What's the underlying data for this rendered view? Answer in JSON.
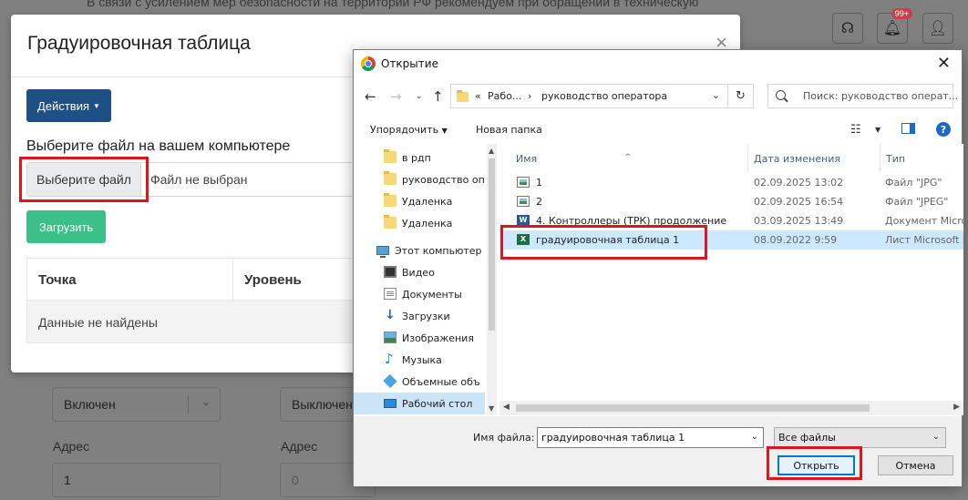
{
  "background": {
    "notice": "В связи с усилением мер безопасности на территории РФ рекомендуем при обращении в техническую",
    "notifications_badge": "99+",
    "fields": [
      {
        "value": "Включен"
      },
      {
        "value": "Выключен"
      }
    ],
    "address_label": "Адрес",
    "address_values": [
      "1",
      "0"
    ]
  },
  "modal": {
    "title": "Градуировочная таблица",
    "close": "×",
    "actions_label": "Действия",
    "choose_label": "Выберите файл на вашем компьютере",
    "choose_button": "Выберите файл",
    "file_status": "Файл не выбран",
    "upload_button": "Загрузить",
    "table": {
      "columns": [
        "Точка",
        "Уровень"
      ],
      "empty": "Данные не найдены"
    }
  },
  "dialog": {
    "title": "Открытие",
    "close": "✕",
    "breadcrumb": {
      "prefix": "«",
      "parent": "Рабо...",
      "separator": "›",
      "current": "руководство оператора"
    },
    "search_placeholder": "Поиск: руководство операт...",
    "toolbar": {
      "organize": "Упорядочить",
      "new_folder": "Новая папка"
    },
    "nav_items": [
      {
        "label": "в рдп",
        "icon": "folder-icon"
      },
      {
        "label": "руководство оп",
        "icon": "folder-icon"
      },
      {
        "label": "Удаленка",
        "icon": "folder-icon"
      },
      {
        "label": "Удаленка",
        "icon": "folder-icon"
      },
      {
        "label": "Этот компьютер",
        "icon": "computer-icon"
      },
      {
        "label": "Видео",
        "icon": "video-icon"
      },
      {
        "label": "Документы",
        "icon": "documents-icon"
      },
      {
        "label": "Загрузки",
        "icon": "downloads-icon"
      },
      {
        "label": "Изображения",
        "icon": "pictures-icon"
      },
      {
        "label": "Музыка",
        "icon": "music-icon"
      },
      {
        "label": "Объемные объ",
        "icon": "3d-objects-icon"
      },
      {
        "label": "Рабочий стол",
        "icon": "desktop-icon"
      }
    ],
    "columns": {
      "name": "Имя",
      "date": "Дата изменения",
      "type": "Тип"
    },
    "files": [
      {
        "name": "1",
        "date": "02.09.2025 13:02",
        "type": "Файл \"JPG\"",
        "icon": "image-file-icon"
      },
      {
        "name": "2",
        "date": "02.09.2025 16:54",
        "type": "Файл \"JPEG\"",
        "icon": "image-file-icon"
      },
      {
        "name": "4. Контроллеры (ТРК) продолжение",
        "date": "03.09.2025 13:49",
        "type": "Документ Micro",
        "icon": "word-file-icon"
      },
      {
        "name": "градуировочная таблица 1",
        "date": "08.09.2022 9:59",
        "type": "Лист Microsoft E",
        "icon": "excel-file-icon",
        "selected": true
      }
    ],
    "filename_label": "Имя файла:",
    "filename_value": "градуировочная таблица 1",
    "filetype_value": "Все файлы",
    "open_button": "Открыть",
    "cancel_button": "Отмена"
  },
  "colors": {
    "annotation": "#e0141f",
    "actions_button": "#1e4f85",
    "upload_button": "#3cc08a",
    "selection": "#cce8ff"
  }
}
